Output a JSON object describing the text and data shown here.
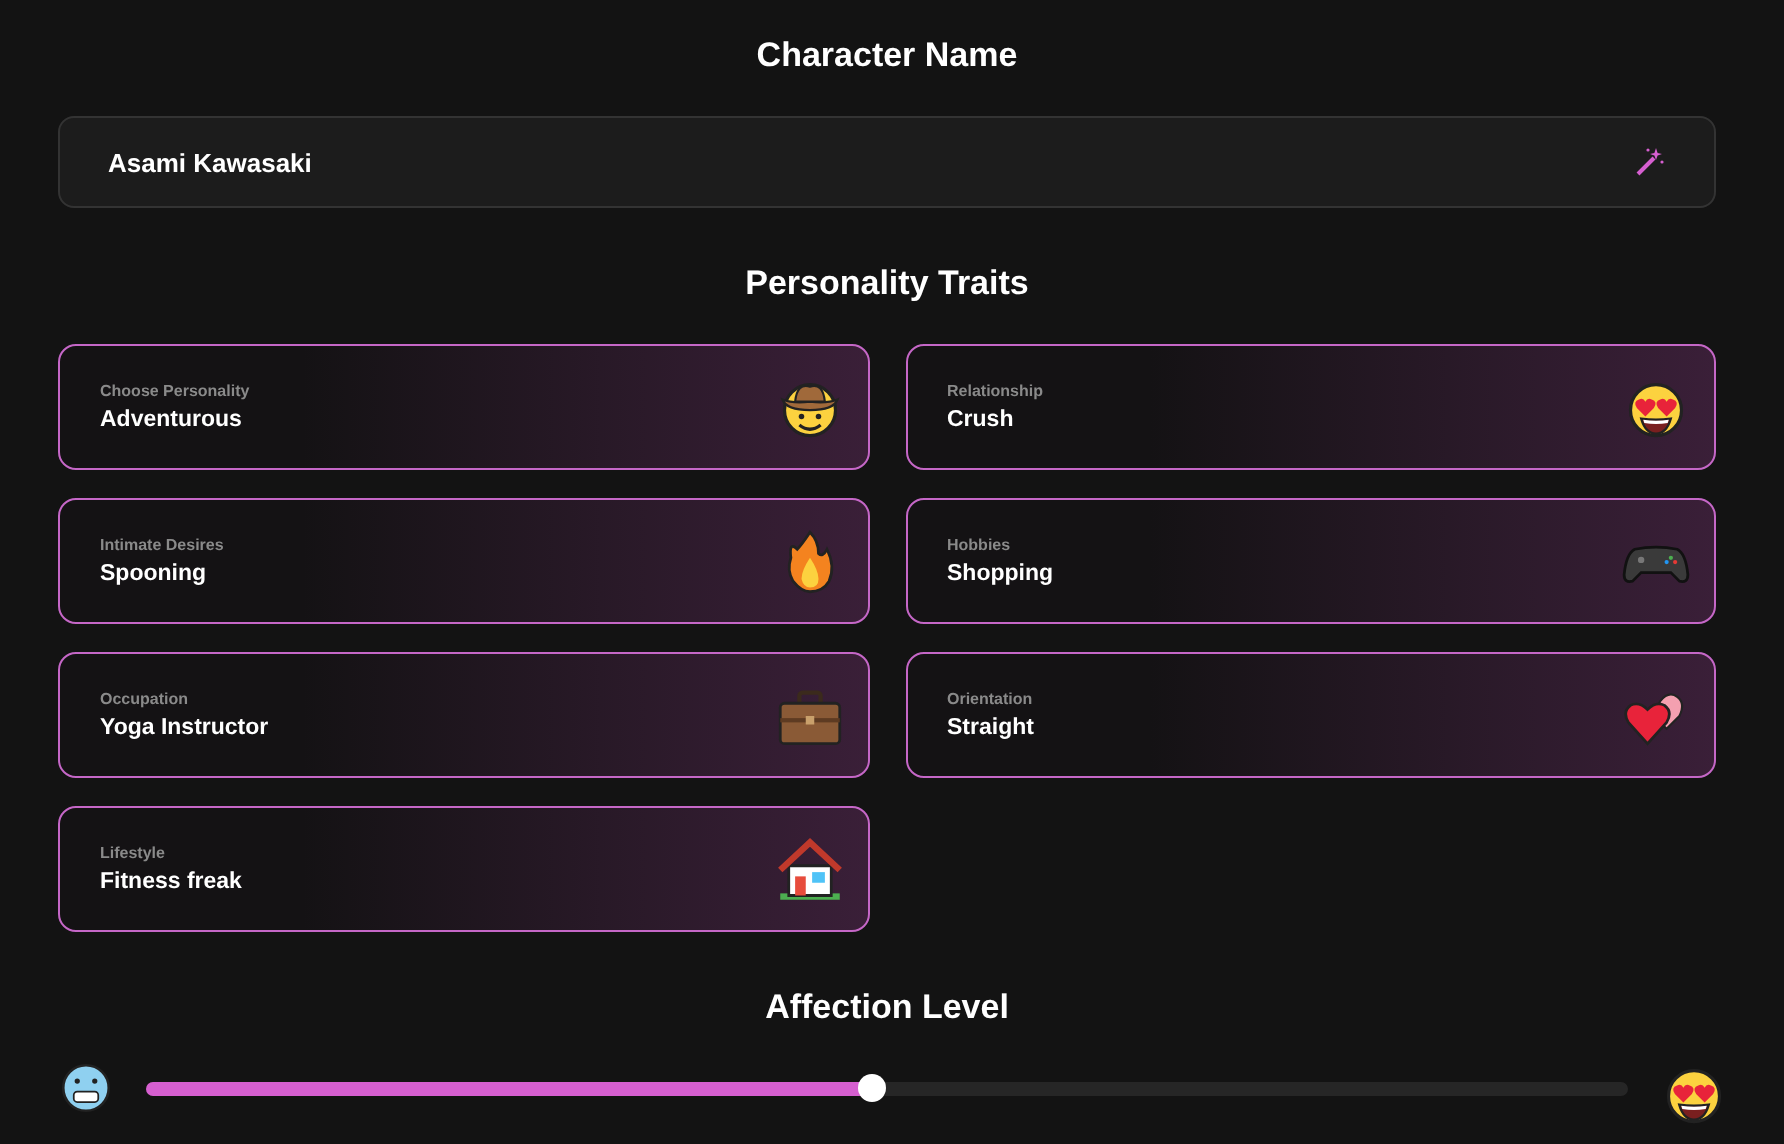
{
  "name_section": {
    "title": "Character Name",
    "value": "Asami Kawasaki"
  },
  "traits_section": {
    "title": "Personality Traits",
    "traits": [
      {
        "label": "Choose Personality",
        "value": "Adventurous"
      },
      {
        "label": "Relationship",
        "value": "Crush"
      },
      {
        "label": "Intimate Desires",
        "value": "Spooning"
      },
      {
        "label": "Hobbies",
        "value": "Shopping"
      },
      {
        "label": "Occupation",
        "value": "Yoga Instructor"
      },
      {
        "label": "Orientation",
        "value": "Straight"
      },
      {
        "label": "Lifestyle",
        "value": "Fitness freak"
      }
    ]
  },
  "affection": {
    "title": "Affection Level",
    "level": 0.49
  }
}
